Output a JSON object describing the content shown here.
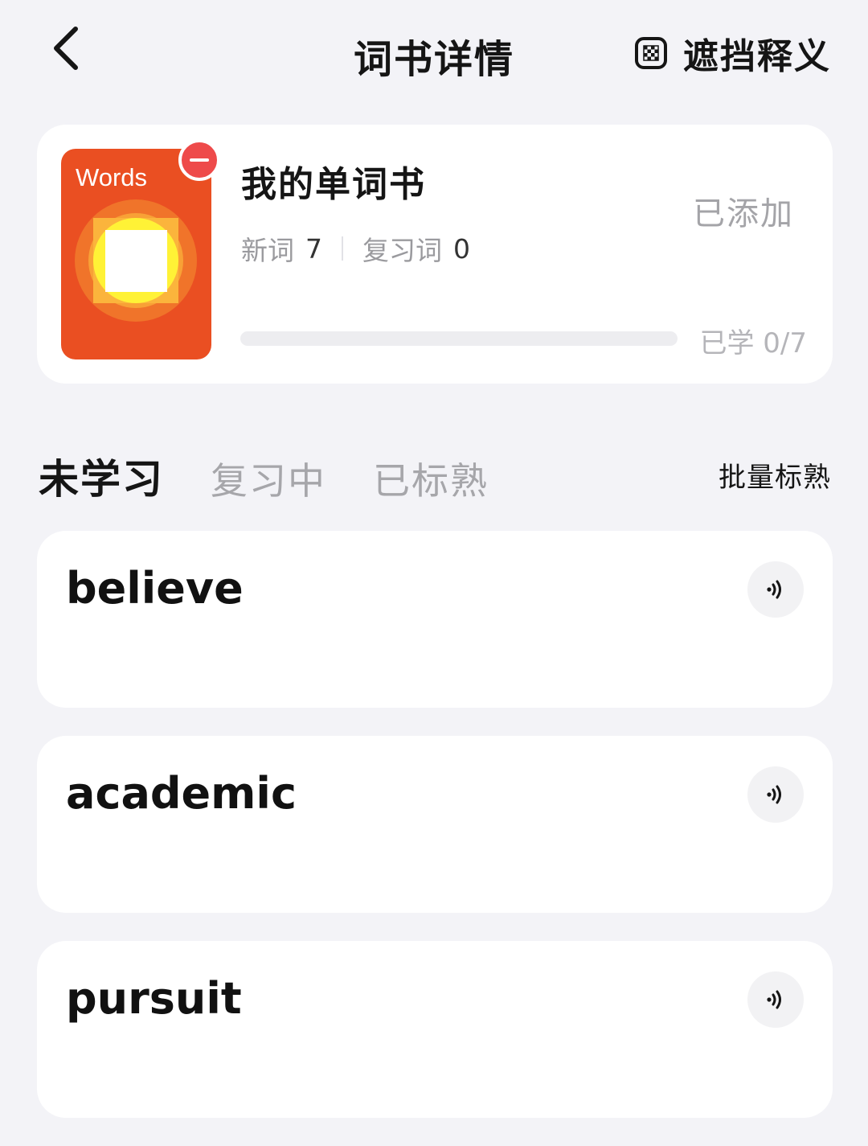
{
  "header": {
    "title": "词书详情",
    "mask_label": "遮挡释义",
    "back_icon": "chevron-left-icon",
    "mask_icon": "mosaic-checkbox-icon"
  },
  "book": {
    "cover_title": "Words",
    "cover_color": "#ea4f22",
    "name": "我的单词书",
    "new_words_label": "新词",
    "new_words_count": "7",
    "review_words_label": "复习词",
    "review_words_count": "0",
    "status": "已添加",
    "progress_text": "已学 0/7",
    "progress_fraction": 0
  },
  "tabs": [
    {
      "label": "未学习",
      "active": true
    },
    {
      "label": "复习中",
      "active": false
    },
    {
      "label": "已标熟",
      "active": false
    }
  ],
  "batch_action": "批量标熟",
  "words": [
    {
      "word": "believe"
    },
    {
      "word": "academic"
    },
    {
      "word": "pursuit"
    }
  ]
}
